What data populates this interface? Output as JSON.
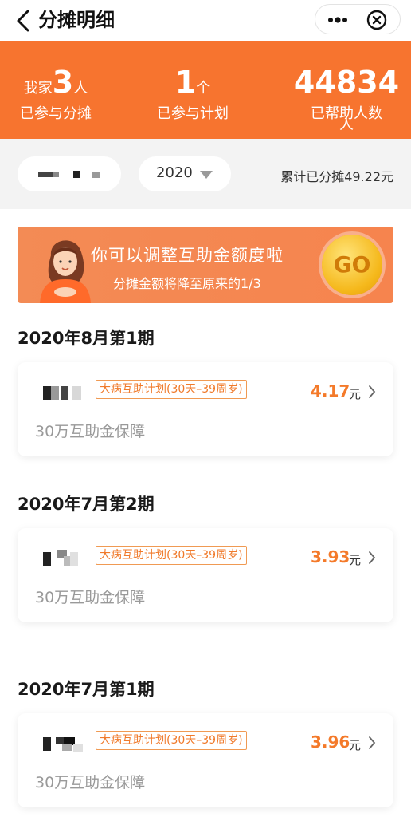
{
  "header": {
    "title": "分摊明细",
    "back_icon": "chevron-left-icon",
    "more_icon": "more-dots-icon",
    "close_icon": "close-circle-icon"
  },
  "stats": [
    {
      "prefix": "我家",
      "value": "3",
      "suffix": "人",
      "label": "已参与分摊"
    },
    {
      "prefix": "",
      "value": "1",
      "suffix": "个",
      "label": "已参与计划"
    },
    {
      "prefix": "",
      "value": "44834",
      "suffix": "人",
      "label": "已帮助人数"
    }
  ],
  "filter": {
    "year": "2020",
    "total": "累计已分摊49.22元"
  },
  "banner": {
    "title": "你可以调整互助金额度啦",
    "subtitle": "分摊金额将降至原来的1/3",
    "go": "GO"
  },
  "periods": [
    {
      "heading": "2020年8月第1期",
      "plan": "大病互助计划(30天–39周岁)",
      "amount": "4.17",
      "unit": "元",
      "coverage": "30万互助金保障"
    },
    {
      "heading": "2020年7月第2期",
      "plan": "大病互助计划(30天–39周岁)",
      "amount": "3.93",
      "unit": "元",
      "coverage": "30万互助金保障"
    },
    {
      "heading": "2020年7月第1期",
      "plan": "大病互助计划(30天–39周岁)",
      "amount": "3.96",
      "unit": "元",
      "coverage": "30万互助金保障"
    }
  ],
  "colors": {
    "accent": "#f7742f",
    "amount": "#f47a2a",
    "background": "#f3f3f3"
  }
}
